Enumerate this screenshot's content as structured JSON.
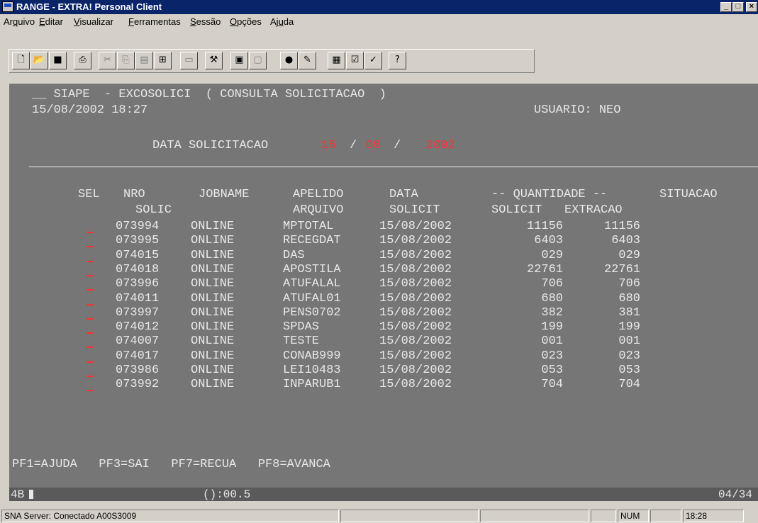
{
  "window": {
    "title": "RANGE - EXTRA! Personal Client"
  },
  "menu": [
    "Arquivo",
    "Editar",
    "Visualizar",
    "Ferramentas",
    "Sessão",
    "Opções",
    "Ajuda"
  ],
  "toolbar": [
    "new-icon",
    "open-icon",
    "save-icon",
    "print-icon",
    "cut-icon",
    "copy-icon",
    "paste-icon",
    "capture-icon",
    "transfer-icon",
    "macro-icon",
    "print-screen-icon",
    "clear-icon",
    "record-icon",
    "edit-macro-icon",
    "setup-icon",
    "settings-icon",
    "options-icon",
    "help-context-icon"
  ],
  "terminal": {
    "line1": "__ SIAPE  - EXCOSOLICI  ( CONSULTA SOLICITACAO  )",
    "datetime": "15/08/2002 18:27",
    "user": "USUARIO: NEO",
    "date_label": "DATA SOLICITACAO",
    "date_day": "15",
    "date_sep1": "/",
    "date_month": "08",
    "date_sep2": "/",
    "date_year": "2002",
    "headers": {
      "sel": "SEL",
      "nro": "NRO",
      "solic": "SOLIC",
      "jobname": "JOBNAME",
      "apelido": "APELIDO",
      "arquivo": "ARQUIVO",
      "data": "DATA",
      "solicit": "SOLICIT",
      "quantidade": "-- QUANTIDADE --",
      "q_solicit": "SOLICIT",
      "q_extracao": "EXTRACAO",
      "situacao": "SITUACAO"
    },
    "rows": [
      {
        "nro": "073994",
        "job": "ONLINE",
        "arquivo": "MPTOTAL",
        "data": "15/08/2002",
        "solicit": "11156",
        "extracao": "11156"
      },
      {
        "nro": "073995",
        "job": "ONLINE",
        "arquivo": "RECEGDAT",
        "data": "15/08/2002",
        "solicit": "6403",
        "extracao": "6403"
      },
      {
        "nro": "074015",
        "job": "ONLINE",
        "arquivo": "DAS",
        "data": "15/08/2002",
        "solicit": "029",
        "extracao": "029"
      },
      {
        "nro": "074018",
        "job": "ONLINE",
        "arquivo": "APOSTILA",
        "data": "15/08/2002",
        "solicit": "22761",
        "extracao": "22761"
      },
      {
        "nro": "073996",
        "job": "ONLINE",
        "arquivo": "ATUFALAL",
        "data": "15/08/2002",
        "solicit": "706",
        "extracao": "706"
      },
      {
        "nro": "074011",
        "job": "ONLINE",
        "arquivo": "ATUFAL01",
        "data": "15/08/2002",
        "solicit": "680",
        "extracao": "680"
      },
      {
        "nro": "073997",
        "job": "ONLINE",
        "arquivo": "PENS0702",
        "data": "15/08/2002",
        "solicit": "382",
        "extracao": "381"
      },
      {
        "nro": "074012",
        "job": "ONLINE",
        "arquivo": "SPDAS",
        "data": "15/08/2002",
        "solicit": "199",
        "extracao": "199"
      },
      {
        "nro": "074007",
        "job": "ONLINE",
        "arquivo": "TESTE",
        "data": "15/08/2002",
        "solicit": "001",
        "extracao": "001"
      },
      {
        "nro": "074017",
        "job": "ONLINE",
        "arquivo": "CONAB999",
        "data": "15/08/2002",
        "solicit": "023",
        "extracao": "023"
      },
      {
        "nro": "073986",
        "job": "ONLINE",
        "arquivo": "LEI10483",
        "data": "15/08/2002",
        "solicit": "053",
        "extracao": "053"
      },
      {
        "nro": "073992",
        "job": "ONLINE",
        "arquivo": "INPARUB1",
        "data": "15/08/2002",
        "solicit": "704",
        "extracao": "704"
      }
    ],
    "pf_keys": "PF1=AJUDA   PF3=SAI   PF7=RECUA   PF8=AVANCA"
  },
  "oia": {
    "left": "4B",
    "mid": "():00.5",
    "right": "04/34"
  },
  "status": {
    "server": "SNA Server: Conectado A00S3009",
    "num": "NUM",
    "time": "18:28"
  }
}
